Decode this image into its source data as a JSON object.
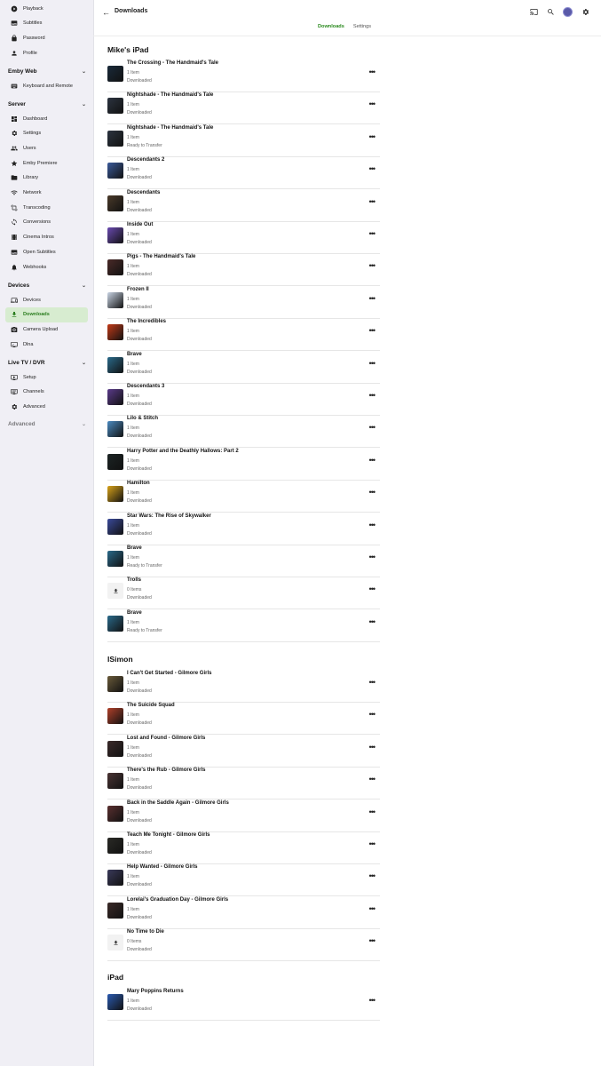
{
  "sidebar": {
    "items_top": [
      {
        "label": "Playback",
        "icon": "play-circle-icon"
      },
      {
        "label": "Subtitles",
        "icon": "subtitles-icon"
      },
      {
        "label": "Password",
        "icon": "lock-icon"
      },
      {
        "label": "Profile",
        "icon": "person-icon"
      }
    ],
    "sections": [
      {
        "title": "Emby Web",
        "items": [
          {
            "label": "Keyboard and Remote",
            "icon": "keyboard-icon"
          }
        ]
      },
      {
        "title": "Server",
        "items": [
          {
            "label": "Dashboard",
            "icon": "dashboard-icon"
          },
          {
            "label": "Settings",
            "icon": "gear-icon"
          },
          {
            "label": "Users",
            "icon": "users-icon"
          },
          {
            "label": "Emby Premiere",
            "icon": "star-icon"
          },
          {
            "label": "Library",
            "icon": "folder-icon"
          },
          {
            "label": "Network",
            "icon": "wifi-icon"
          },
          {
            "label": "Transcoding",
            "icon": "crop-icon"
          },
          {
            "label": "Conversions",
            "icon": "sync-icon"
          },
          {
            "label": "Cinema Intros",
            "icon": "film-icon"
          },
          {
            "label": "Open Subtitles",
            "icon": "subtitles-icon"
          },
          {
            "label": "Webhooks",
            "icon": "bell-icon"
          }
        ]
      },
      {
        "title": "Devices",
        "items": [
          {
            "label": "Devices",
            "icon": "devices-icon"
          },
          {
            "label": "Downloads",
            "icon": "download-icon"
          },
          {
            "label": "Camera Upload",
            "icon": "camera-icon"
          },
          {
            "label": "Dlna",
            "icon": "cast-screen-icon"
          }
        ]
      },
      {
        "title": "Live TV / DVR",
        "items": [
          {
            "label": "Setup",
            "icon": "tv-icon"
          },
          {
            "label": "Channels",
            "icon": "list-icon"
          },
          {
            "label": "Advanced",
            "icon": "gear-icon"
          }
        ]
      },
      {
        "title": "Advanced",
        "items": []
      }
    ]
  },
  "header": {
    "back_icon": "arrow-left-icon",
    "title": "Downloads",
    "tabs": [
      "Downloads",
      "Settings"
    ],
    "icons": [
      "cast-icon",
      "search-icon",
      "user-avatar-icon",
      "gear-icon"
    ]
  },
  "devices": [
    {
      "name": "Mike's iPad",
      "items": [
        {
          "title": "The Crossing - The Handmaid's Tale",
          "count": "1 Item",
          "status": "Downloaded",
          "color": "#1a2a3a"
        },
        {
          "title": "Nightshade - The Handmaid's Tale",
          "count": "1 Item",
          "status": "Downloaded",
          "color": "#2c3440"
        },
        {
          "title": "Nightshade - The Handmaid's Tale",
          "count": "1 Item",
          "status": "Ready to Transfer",
          "color": "#2c3440"
        },
        {
          "title": "Descendants 2",
          "count": "1 Item",
          "status": "Downloaded",
          "color": "#3a5a9a"
        },
        {
          "title": "Descendants",
          "count": "1 Item",
          "status": "Downloaded",
          "color": "#4a3a2a"
        },
        {
          "title": "Inside Out",
          "count": "1 Item",
          "status": "Downloaded",
          "color": "#6a4ab0"
        },
        {
          "title": "Pigs - The Handmaid's Tale",
          "count": "1 Item",
          "status": "Downloaded",
          "color": "#4a2a28"
        },
        {
          "title": "Frozen II",
          "count": "1 Item",
          "status": "Downloaded",
          "color": "#c9d4e4"
        },
        {
          "title": "The Incredibles",
          "count": "1 Item",
          "status": "Downloaded",
          "color": "#c23a18"
        },
        {
          "title": "Brave",
          "count": "1 Item",
          "status": "Downloaded",
          "color": "#2a6a8a"
        },
        {
          "title": "Descendants 3",
          "count": "1 Item",
          "status": "Downloaded",
          "color": "#5a3a8a"
        },
        {
          "title": "Lilo & Stitch",
          "count": "1 Item",
          "status": "Downloaded",
          "color": "#4a8ac0"
        },
        {
          "title": "Harry Potter and the Deathly Hallows: Part 2",
          "count": "1 Item",
          "status": "Downloaded",
          "color": "#1c2424"
        },
        {
          "title": "Hamilton",
          "count": "1 Item",
          "status": "Downloaded",
          "color": "#d8a21a"
        },
        {
          "title": "Star Wars: The Rise of Skywalker",
          "count": "1 Item",
          "status": "Downloaded",
          "color": "#3a4a9a"
        },
        {
          "title": "Brave",
          "count": "1 Item",
          "status": "Ready to Transfer",
          "color": "#2a6a8a"
        },
        {
          "title": "Trolls",
          "count": "0 Items",
          "status": "Downloaded",
          "color": "",
          "placeholder": true
        },
        {
          "title": "Brave",
          "count": "1 Item",
          "status": "Ready to Transfer",
          "color": "#2a6a8a"
        }
      ]
    },
    {
      "name": "ISimon",
      "items": [
        {
          "title": "I Can't Get Started - Gilmore Girls",
          "count": "1 Item",
          "status": "Downloaded",
          "color": "#6a5a3a"
        },
        {
          "title": "The Suicide Squad",
          "count": "1 Item",
          "status": "Downloaded",
          "color": "#b0402a"
        },
        {
          "title": "Lost and Found - Gilmore Girls",
          "count": "1 Item",
          "status": "Downloaded",
          "color": "#3a2a2a"
        },
        {
          "title": "There's the Rub - Gilmore Girls",
          "count": "1 Item",
          "status": "Downloaded",
          "color": "#4a3434"
        },
        {
          "title": "Back in the Saddle Again - Gilmore Girls",
          "count": "1 Item",
          "status": "Downloaded",
          "color": "#5a3030"
        },
        {
          "title": "Teach Me Tonight - Gilmore Girls",
          "count": "1 Item",
          "status": "Downloaded",
          "color": "#2a2a26"
        },
        {
          "title": "Help Wanted - Gilmore Girls",
          "count": "1 Item",
          "status": "Downloaded",
          "color": "#3a3a5a"
        },
        {
          "title": "Lorelai's Graduation Day - Gilmore Girls",
          "count": "1 Item",
          "status": "Downloaded",
          "color": "#3a2a28"
        },
        {
          "title": "No Time to Die",
          "count": "0 Items",
          "status": "Downloaded",
          "color": "",
          "placeholder": true
        }
      ]
    },
    {
      "name": "iPad",
      "items": [
        {
          "title": "Mary Poppins Returns",
          "count": "1 Item",
          "status": "Downloaded",
          "color": "#2a5ab0"
        }
      ]
    }
  ]
}
